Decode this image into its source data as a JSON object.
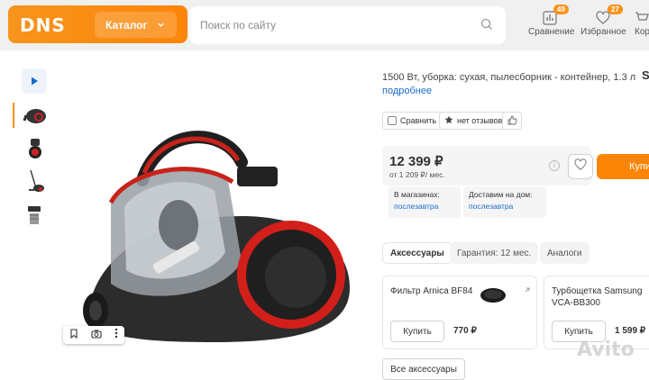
{
  "header": {
    "logo_text": "DNS",
    "catalog_label": "Каталог",
    "search_placeholder": "Поиск по сайту",
    "compare_label": "Сравнение",
    "compare_count": "49",
    "favorites_label": "Избранное",
    "favorites_count": "27",
    "cart_label": "Корз",
    "accent_color": "#fc8507"
  },
  "product": {
    "description": "1500 Вт, уборка: сухая, пылесборник - контейнер, 1.3 л",
    "more_link": "подробнее",
    "right_cut_letter": "S",
    "compare_chip": "Сравнить",
    "reviews_chip": "нет отзывов",
    "price": "12 399 ₽",
    "credit": "от 1 209 ₽/ мес.",
    "buy_label": "Купи",
    "delivery": [
      {
        "title": "В магазинах:",
        "value": "послезавтра"
      },
      {
        "title": "Доставим на дом:",
        "value": "послезавтра"
      }
    ]
  },
  "tabs": [
    {
      "label": "Аксессуары",
      "active": true
    },
    {
      "label": "Гарантия: 12 мес.",
      "active": false
    },
    {
      "label": "Аналоги",
      "active": false
    }
  ],
  "accessories": [
    {
      "name": "Фильтр Arnica BF84",
      "buy": "Купить",
      "price": "770 ₽"
    },
    {
      "name": "Турбощетка Samsung VCA-BB300",
      "buy": "Купить",
      "price": "1 599 ₽"
    }
  ],
  "all_accessories": "Все аксессуары",
  "watermark": "Avito"
}
